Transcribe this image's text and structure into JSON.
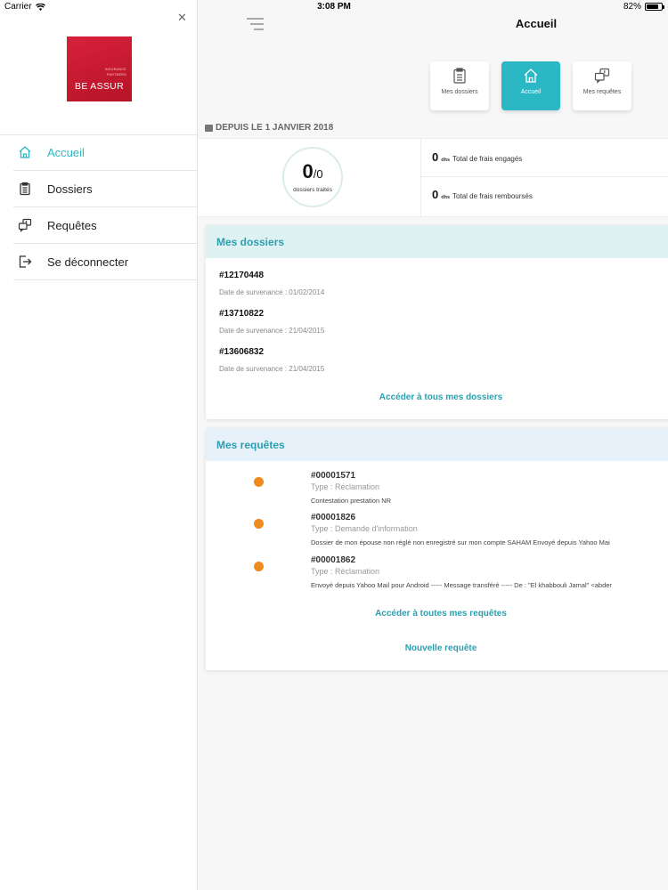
{
  "status_bar": {
    "carrier": "Carrier",
    "time": "3:08 PM",
    "battery": "82%",
    "battery_level": 0.82
  },
  "sidebar": {
    "close_icon": "close-icon",
    "logo": {
      "tagline_1": "INSURANCE",
      "tagline_2": "PARTNERS",
      "brand": "BE ASSUR"
    },
    "items": [
      {
        "label": "Accueil",
        "icon": "home-icon",
        "active": true
      },
      {
        "label": "Dossiers",
        "icon": "clipboard-icon",
        "active": false
      },
      {
        "label": "Requêtes",
        "icon": "requests-icon",
        "active": false
      },
      {
        "label": "Se déconnecter",
        "icon": "logout-icon",
        "active": false
      }
    ]
  },
  "header": {
    "title": "Accueil"
  },
  "tiles": [
    {
      "label": "Mes dossiers",
      "icon": "clipboard-icon",
      "active": false
    },
    {
      "label": "Accueil",
      "icon": "home-icon",
      "active": true
    },
    {
      "label": "Mes requêtes",
      "icon": "requests-icon",
      "active": false
    }
  ],
  "summary": {
    "since": "DEPUIS LE 1 JANVIER 2018",
    "count": "0",
    "count_total": "/0",
    "count_label": "dossiers traités",
    "frais_engages_value": "0",
    "frais_engages_unit": "dhs",
    "frais_engages_label": "Total de frais engagés",
    "frais_rembourses_value": "0",
    "frais_rembourses_unit": "dhs",
    "frais_rembourses_label": "Total de frais remboursés"
  },
  "dossiers": {
    "title": "Mes dossiers",
    "items": [
      {
        "number": "#12170448",
        "date": "Date de survenance : 01/02/2014"
      },
      {
        "number": "#13710822",
        "date": "Date de survenance : 21/04/2015"
      },
      {
        "number": "#13606832",
        "date": "Date de survenance : 21/04/2015"
      }
    ],
    "link": "Accéder à tous mes dossiers"
  },
  "requetes": {
    "title": "Mes requêtes",
    "items": [
      {
        "number": "#00001571",
        "type": "Type : Réclamation",
        "description": "Contestation prestation NR"
      },
      {
        "number": "#00001826",
        "type": "Type : Demande d'information",
        "description": "Dossier de mon épouse non réglé non enregistré sur mon compte SAHAM    Envoyé depuis Yahoo Mai"
      },
      {
        "number": "#00001862",
        "type": "Type : Réclamation",
        "description": "Envoyé depuis Yahoo Mail pour Android   ----- Message transféré ----- De : \"El khabbouli Jamal\" <abder"
      }
    ],
    "status_color": "#ef8a1e",
    "link": "Accéder à toutes mes requêtes",
    "new_link": "Nouvelle requête"
  },
  "colors": {
    "accent": "#2bb7c4",
    "link": "#2a9fb0",
    "brand": "#c8192f"
  }
}
